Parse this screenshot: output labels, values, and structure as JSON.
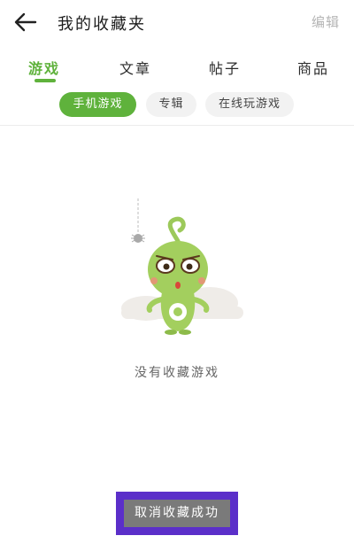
{
  "header": {
    "title": "我的收藏夹",
    "edit_label": "编辑",
    "back_icon": "arrow-left-icon"
  },
  "tabs": [
    {
      "label": "游戏",
      "active": true
    },
    {
      "label": "文章",
      "active": false
    },
    {
      "label": "帖子",
      "active": false
    },
    {
      "label": "商品",
      "active": false
    }
  ],
  "filters": [
    {
      "label": "手机游戏",
      "active": true
    },
    {
      "label": "专辑",
      "active": false
    },
    {
      "label": "在线玩游戏",
      "active": false
    }
  ],
  "empty_state": {
    "message": "没有收藏游戏",
    "illustration": "green-mascot-empty-icon"
  },
  "toast": {
    "message": "取消收藏成功"
  },
  "colors": {
    "accent": "#5fb23c",
    "toast_bg": "#7a7a7a",
    "highlight": "#5b2fc9",
    "edit_disabled": "#b5b5b5"
  }
}
